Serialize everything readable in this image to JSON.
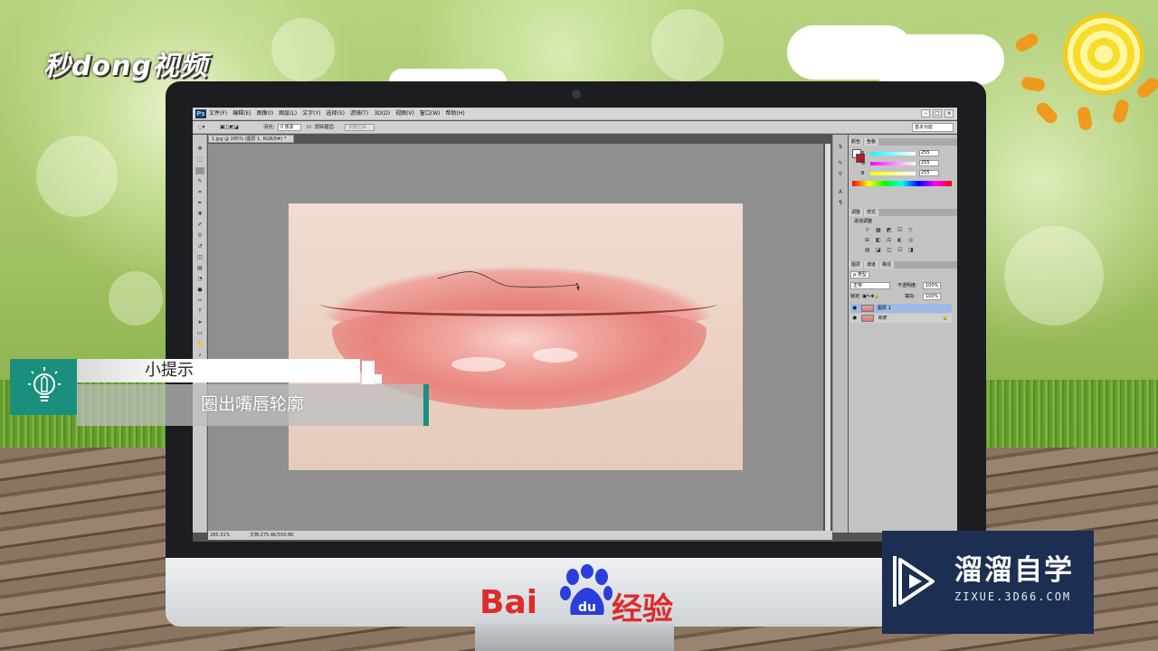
{
  "branding": {
    "miaodong_logo": "秒dong视频",
    "baidu_logo_left": "Bai",
    "baidu_logo_paw": "du",
    "baidu_logo_right": "经验",
    "zixue_name": "溜溜自学",
    "zixue_url": "ZIXUE.3D66.COM"
  },
  "photoshop": {
    "app_icon": "Ps",
    "menu": [
      "文件(F)",
      "编辑(E)",
      "图像(I)",
      "图层(L)",
      "文字(Y)",
      "选择(S)",
      "滤镜(T)",
      "3D(D)",
      "视图(V)",
      "窗口(W)",
      "帮助(H)"
    ],
    "window_controls": [
      "-",
      "□",
      "×"
    ],
    "options": {
      "feather_label": "羽化:",
      "feather_value": "0 像素",
      "antialias_label": "消除锯齿",
      "refine_edge_button": "调整边缘...",
      "workspace": "基本功能"
    },
    "document_tab": "1.jpg @ 285% (图层 1, RGB/8#) *",
    "status": {
      "zoom": "285.31%",
      "doc_size": "文档:275.4K/550.8K"
    },
    "color_panel": {
      "tabs": [
        "颜色",
        "色板"
      ],
      "channels": [
        {
          "label": "R",
          "value": "255",
          "color": "#ff4040"
        },
        {
          "label": "G",
          "value": "255",
          "color": "#e83ad1"
        },
        {
          "label": "B",
          "value": "255",
          "color": "#e6e63a"
        }
      ]
    },
    "adjustments_panel": {
      "tabs": [
        "调整",
        "样式"
      ],
      "label": "添加调整",
      "icons": [
        "☼",
        "▦",
        "◩",
        "☑",
        "▽",
        "⊞",
        "◧",
        "⚖",
        "◐",
        "◎",
        "▤",
        "◪",
        "◫",
        "☑",
        "◨"
      ]
    },
    "layers_panel": {
      "tabs": [
        "图层",
        "通道",
        "路径"
      ],
      "filter_label": "ρ 类型",
      "blend_mode": "正常",
      "opacity_label": "不透明度:",
      "opacity": "100%",
      "lock_label": "锁定:",
      "fill_label": "填充:",
      "fill": "100%",
      "layers": [
        {
          "name": "图层 1",
          "selected": true,
          "locked": false
        },
        {
          "name": "背景",
          "selected": false,
          "locked": true
        }
      ]
    }
  },
  "tip": {
    "title": "小提示",
    "body": "圈出嘴唇轮廓"
  },
  "colors": {
    "tip_accent": "#1b8f7e",
    "zixue_bg": "#1c2e52",
    "baidu_red": "#de2b2b",
    "baidu_blue": "#2b3ddb"
  }
}
